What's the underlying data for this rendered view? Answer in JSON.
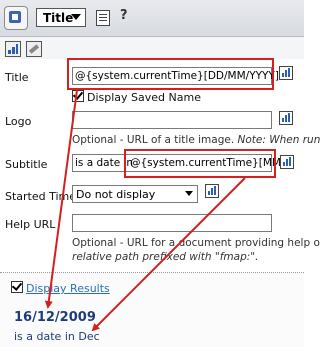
{
  "header": {
    "selected_item": "Title",
    "help_glyph": "?"
  },
  "form": {
    "title": {
      "label": "Title",
      "value": "@{system.currentTime}[DD/MM/YYYY]",
      "checkbox_label": "Display Saved Name"
    },
    "logo": {
      "label": "Logo",
      "help_prefix": "Optional - URL of a title image.",
      "help_italic": "Note: When runn"
    },
    "subtitle": {
      "label": "Subtitle",
      "value_prefix": "is a date in",
      "value_variable": "@{system.currentTime}[MMM]"
    },
    "started_time": {
      "label": "Started Time",
      "value": "Do not display"
    },
    "help_url": {
      "label": "Help URL",
      "help_line1": "Optional - URL for a document providing help on",
      "help_line2": "relative path prefixed with \"fmap:\"."
    }
  },
  "results": {
    "checkbox_label": "Display Results",
    "date": "16/12/2009",
    "subtitle": "is a date in Dec"
  },
  "colors": {
    "callout": "#d61f1f",
    "link": "#2a6fb8",
    "result_text": "#1d3d7a"
  }
}
